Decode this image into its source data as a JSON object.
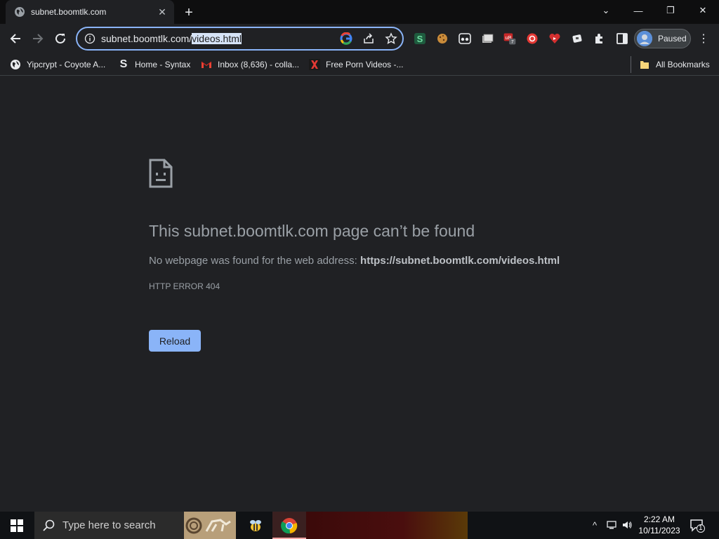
{
  "tab": {
    "title": "subnet.boomtlk.com"
  },
  "omnibox": {
    "host": "subnet.boomtlk.com/",
    "path": "videos.html"
  },
  "profile": {
    "label": "Paused"
  },
  "bookmarks": {
    "items": [
      {
        "label": "Yipcrypt - Coyote A..."
      },
      {
        "label": "Home - Syntax"
      },
      {
        "label": "Inbox (8,636) - colla..."
      },
      {
        "label": "Free Porn Videos -..."
      }
    ],
    "all_label": "All Bookmarks"
  },
  "error": {
    "title": "This subnet.boomtlk.com page can’t be found",
    "desc_prefix": "No webpage was found for the web address: ",
    "desc_url": "https://subnet.boomtlk.com/videos.html",
    "code": "HTTP ERROR 404",
    "reload_label": "Reload"
  },
  "taskbar": {
    "search_placeholder": "Type here to search",
    "time": "2:22 AM",
    "date": "10/11/2023",
    "notification_count": "1"
  },
  "colors": {
    "accent": "#8ab4f8",
    "background": "#202124",
    "text_muted": "#9aa0a6"
  }
}
